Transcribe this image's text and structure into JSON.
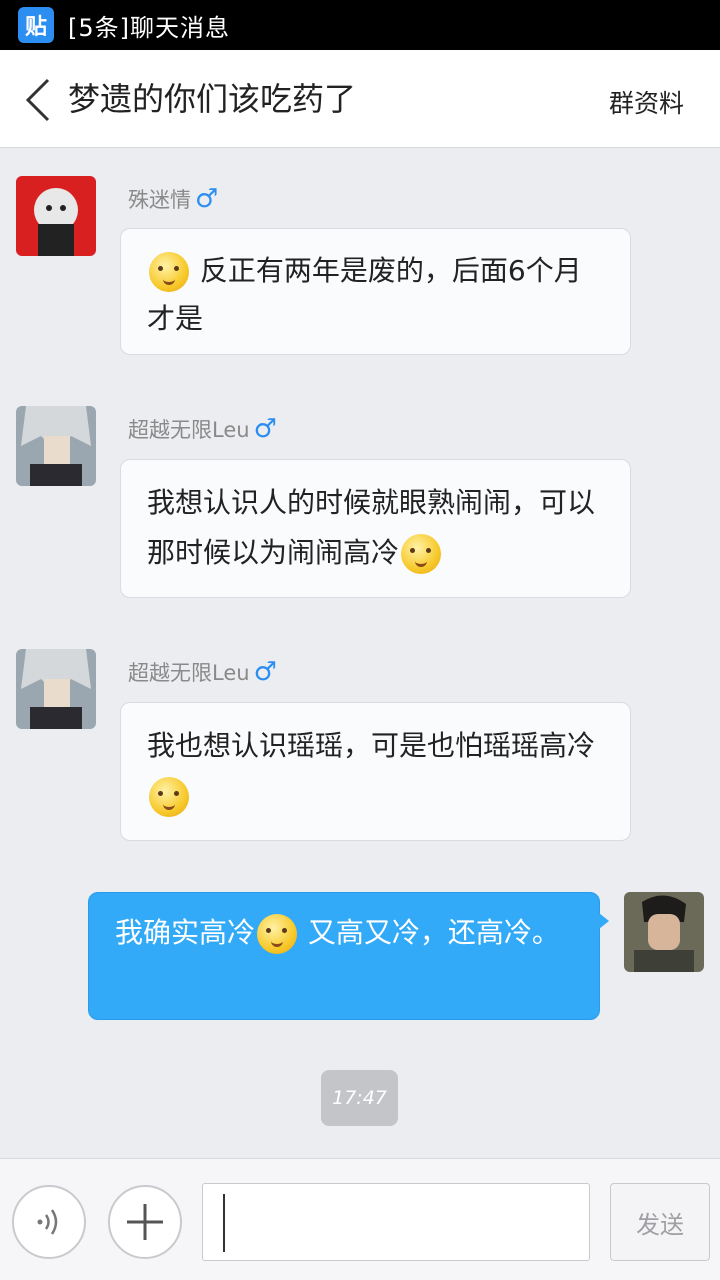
{
  "statusbar": {
    "app_icon_label": "贴",
    "notification": "[5条]聊天消息"
  },
  "header": {
    "title": "梦遗的你们该吃药了",
    "group_info": "群资料"
  },
  "male_symbol": "♂",
  "messages": [
    {
      "nickname": "殊迷情",
      "parts": [
        "",
        "反正有两年是废的，后面6个月才是"
      ]
    },
    {
      "nickname": "超越无限Leu",
      "text": "我想认识人的时候就眼熟闹闹，可以那时候以为闹闹高冷"
    },
    {
      "nickname": "超越无限Leu",
      "text": "我也想认识瑶瑶，可是也怕瑶瑶高冷"
    },
    {
      "nickname": "",
      "part1": "我确实高冷",
      "part2": " 又高又冷，还高冷。"
    }
  ],
  "timestamp": "17:47",
  "input": {
    "value": "",
    "send_label": "发送"
  },
  "colors": {
    "accent": "#33aaf8",
    "male": "#2c8ef0"
  }
}
